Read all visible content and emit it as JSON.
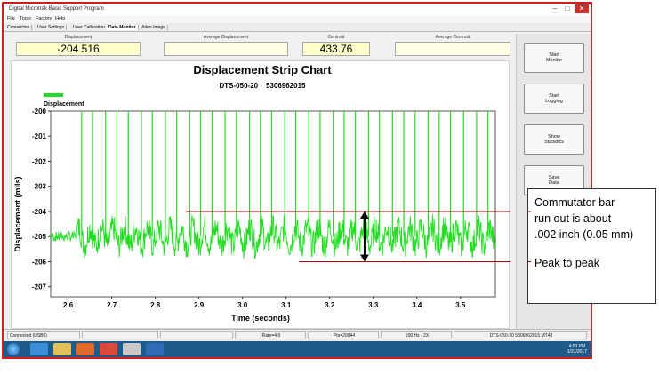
{
  "window": {
    "title": "Digital Microtrak Basic Support Program",
    "controls": [
      "–",
      "□",
      "✕"
    ]
  },
  "menu": [
    "File",
    "Tools",
    "Factory",
    "Help"
  ],
  "tabs": [
    {
      "label": "Connection",
      "active": false
    },
    {
      "label": "User Settings",
      "active": false
    },
    {
      "label": "User Calibration",
      "active": false
    },
    {
      "label": "Data Monitor",
      "active": true
    },
    {
      "label": "Video Image",
      "active": false
    }
  ],
  "readouts": {
    "displacement_label": "Displacement",
    "displacement_value": "-204.516",
    "avg_displacement_label": "Average Displacement",
    "avg_displacement_value": "",
    "centroid_label": "Centroid",
    "centroid_value": "433.76",
    "avg_centroid_label": "Average Centroid",
    "avg_centroid_value": ""
  },
  "side_buttons": [
    "Start\nMonitor",
    "Start\nLogging",
    "Show\nStatistics",
    "Save\nData"
  ],
  "chart_data": {
    "type": "line",
    "title": "Displacement Strip Chart",
    "subtitle": "DTS-050-20    5306962015",
    "xlabel": "Time (seconds)",
    "ylabel": "Displacement (mils)",
    "xlim": [
      2.56,
      3.58
    ],
    "ylim": [
      -207.4,
      -200.0
    ],
    "xticks": [
      "2.6",
      "2.7",
      "2.8",
      "2.9",
      "3.0",
      "3.1",
      "3.2",
      "3.3",
      "3.4",
      "3.5"
    ],
    "yticks": [
      "-200",
      "-201",
      "-202",
      "-203",
      "-204",
      "-205",
      "-206",
      "-207"
    ],
    "grid": true,
    "series": [
      {
        "name": "Displacement",
        "color": "#22dd22",
        "baseline_range": [
          -206.0,
          -204.0
        ],
        "spike_times": [
          2.631,
          2.656,
          2.686,
          2.712,
          2.738,
          2.768,
          2.793,
          2.823,
          2.849,
          2.879,
          2.904,
          2.93,
          2.96,
          2.986,
          3.016,
          3.041,
          3.067,
          3.097,
          3.122,
          3.152,
          3.178,
          3.208,
          3.233,
          3.259,
          3.289,
          3.314,
          3.344,
          3.37,
          3.396,
          3.426,
          3.451,
          3.477,
          3.507,
          3.537,
          3.563
        ]
      }
    ],
    "annotations": [
      {
        "text": "Commutator bar run out is about .002 inch (0.05 mm)",
        "y_from": -204.0,
        "y_to": -206.0,
        "x": 3.28
      },
      {
        "text": "Peak to peak"
      }
    ]
  },
  "annotation_box": {
    "lines": [
      "Commutator bar",
      "run out is about",
      ".002 inch (0.05 mm)"
    ],
    "footer": "Peak to peak"
  },
  "statusbar": {
    "connection": "Connected (USB0)",
    "rate": "Rate=4.9",
    "pts": "Pts=29944",
    "freq": "500 Hz  -  2X",
    "device": "DTS-050-20    5306962015    MT48"
  },
  "clock": {
    "time": "4:53 PM",
    "date": "1/31/2017"
  }
}
